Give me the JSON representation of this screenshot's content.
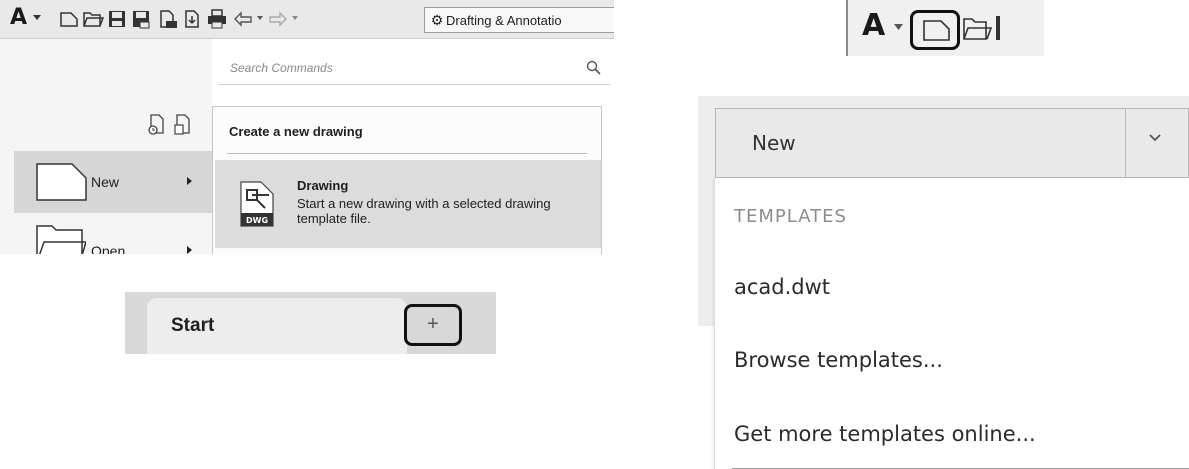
{
  "app_menu": {
    "workspace": "Drafting & Annotatio",
    "search_placeholder": "Search Commands",
    "items": [
      {
        "label": "New"
      },
      {
        "label": "Open"
      }
    ],
    "flyout": {
      "header": "Create a new drawing",
      "drawing_title": "Drawing",
      "drawing_description": "Start a new drawing with a selected drawing template file.",
      "icon_badge": "DWG"
    },
    "logo": "A"
  },
  "toolbar_zoom": {
    "logo": "A"
  },
  "tabs": {
    "start_label": "Start",
    "plus_label": "+"
  },
  "new_dropdown": {
    "button_label": "New",
    "section_heading": "TEMPLATES",
    "options": [
      "acad.dwt",
      "Browse templates...",
      "Get more templates online..."
    ]
  },
  "colors": {
    "highlight": "#d6d6d6",
    "callout_border": "#111111"
  }
}
